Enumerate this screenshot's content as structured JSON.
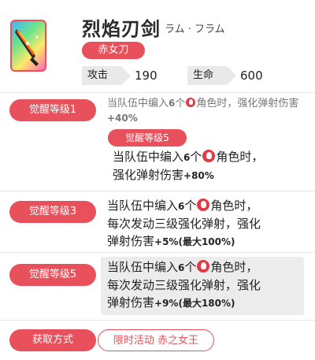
{
  "header": {
    "title": "烈焰刃剑",
    "subtitle": "ラム · フラム",
    "type_badge": "赤女刀",
    "stats": [
      {
        "label": "攻击",
        "value": "190"
      },
      {
        "label": "生命",
        "value": "600"
      }
    ]
  },
  "colors": {
    "accent": "#e8505b",
    "divider": "#e6e6e6",
    "stat_bg": "#e9e9e9"
  },
  "awakening": [
    {
      "label": "觉醒等级1",
      "text": {
        "pre": "当队伍中编入",
        "num": "6",
        "mid": "个",
        "post": "角色时，强化弹射伤害",
        "bonus": "+40%"
      }
    },
    {
      "sub_label": "觉醒等级5",
      "text": {
        "pre": "当队伍中编入",
        "num": "6",
        "mid": "个",
        "post1": "角色时，",
        "post2": "强化弹射伤害",
        "bonus": "+80%"
      }
    },
    {
      "label": "觉醒等级3",
      "text": {
        "pre": "当队伍中编入",
        "num": "6",
        "mid": "个",
        "post1": "角色时，",
        "line2": "每次发动三级强化弹射，强化",
        "line3": "弹射伤害",
        "bonus": "+5%",
        "max": "(最大100%)"
      }
    },
    {
      "label": "觉醒等级5",
      "text": {
        "pre": "当队伍中编入",
        "num": "6",
        "mid": "个",
        "post1": "角色时，",
        "line2": "每次发动三级强化弹射，强化",
        "line3": "弹射伤害",
        "bonus": "+9%",
        "max": "(最大180%)"
      }
    }
  ],
  "acquire": {
    "label": "获取方式",
    "value": "限时活动 赤之女王"
  },
  "icons": {
    "element": "fire-element-icon",
    "weapon": "flame-sword-icon"
  }
}
